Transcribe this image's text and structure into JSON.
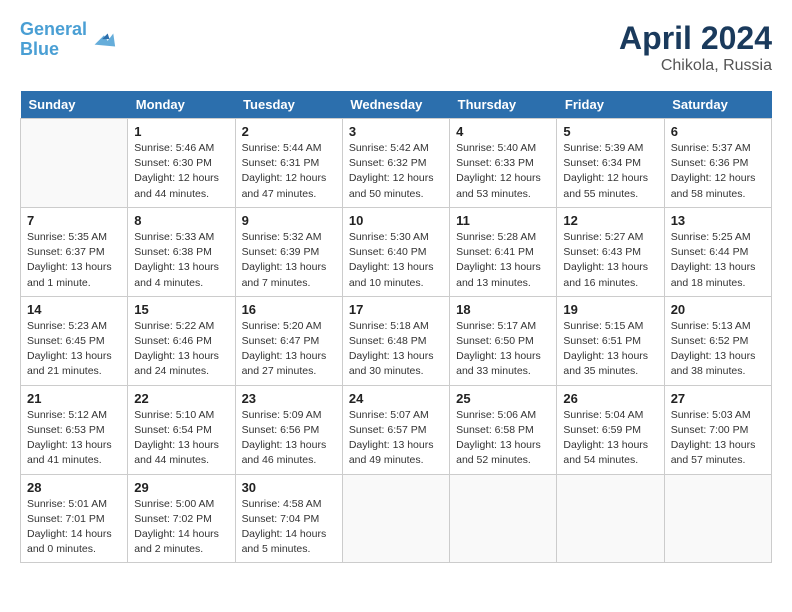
{
  "header": {
    "logo_line1": "General",
    "logo_line2": "Blue",
    "month": "April 2024",
    "location": "Chikola, Russia"
  },
  "days_of_week": [
    "Sunday",
    "Monday",
    "Tuesday",
    "Wednesday",
    "Thursday",
    "Friday",
    "Saturday"
  ],
  "weeks": [
    [
      {
        "date": "",
        "info": ""
      },
      {
        "date": "1",
        "info": "Sunrise: 5:46 AM\nSunset: 6:30 PM\nDaylight: 12 hours\nand 44 minutes."
      },
      {
        "date": "2",
        "info": "Sunrise: 5:44 AM\nSunset: 6:31 PM\nDaylight: 12 hours\nand 47 minutes."
      },
      {
        "date": "3",
        "info": "Sunrise: 5:42 AM\nSunset: 6:32 PM\nDaylight: 12 hours\nand 50 minutes."
      },
      {
        "date": "4",
        "info": "Sunrise: 5:40 AM\nSunset: 6:33 PM\nDaylight: 12 hours\nand 53 minutes."
      },
      {
        "date": "5",
        "info": "Sunrise: 5:39 AM\nSunset: 6:34 PM\nDaylight: 12 hours\nand 55 minutes."
      },
      {
        "date": "6",
        "info": "Sunrise: 5:37 AM\nSunset: 6:36 PM\nDaylight: 12 hours\nand 58 minutes."
      }
    ],
    [
      {
        "date": "7",
        "info": "Sunrise: 5:35 AM\nSunset: 6:37 PM\nDaylight: 13 hours\nand 1 minute."
      },
      {
        "date": "8",
        "info": "Sunrise: 5:33 AM\nSunset: 6:38 PM\nDaylight: 13 hours\nand 4 minutes."
      },
      {
        "date": "9",
        "info": "Sunrise: 5:32 AM\nSunset: 6:39 PM\nDaylight: 13 hours\nand 7 minutes."
      },
      {
        "date": "10",
        "info": "Sunrise: 5:30 AM\nSunset: 6:40 PM\nDaylight: 13 hours\nand 10 minutes."
      },
      {
        "date": "11",
        "info": "Sunrise: 5:28 AM\nSunset: 6:41 PM\nDaylight: 13 hours\nand 13 minutes."
      },
      {
        "date": "12",
        "info": "Sunrise: 5:27 AM\nSunset: 6:43 PM\nDaylight: 13 hours\nand 16 minutes."
      },
      {
        "date": "13",
        "info": "Sunrise: 5:25 AM\nSunset: 6:44 PM\nDaylight: 13 hours\nand 18 minutes."
      }
    ],
    [
      {
        "date": "14",
        "info": "Sunrise: 5:23 AM\nSunset: 6:45 PM\nDaylight: 13 hours\nand 21 minutes."
      },
      {
        "date": "15",
        "info": "Sunrise: 5:22 AM\nSunset: 6:46 PM\nDaylight: 13 hours\nand 24 minutes."
      },
      {
        "date": "16",
        "info": "Sunrise: 5:20 AM\nSunset: 6:47 PM\nDaylight: 13 hours\nand 27 minutes."
      },
      {
        "date": "17",
        "info": "Sunrise: 5:18 AM\nSunset: 6:48 PM\nDaylight: 13 hours\nand 30 minutes."
      },
      {
        "date": "18",
        "info": "Sunrise: 5:17 AM\nSunset: 6:50 PM\nDaylight: 13 hours\nand 33 minutes."
      },
      {
        "date": "19",
        "info": "Sunrise: 5:15 AM\nSunset: 6:51 PM\nDaylight: 13 hours\nand 35 minutes."
      },
      {
        "date": "20",
        "info": "Sunrise: 5:13 AM\nSunset: 6:52 PM\nDaylight: 13 hours\nand 38 minutes."
      }
    ],
    [
      {
        "date": "21",
        "info": "Sunrise: 5:12 AM\nSunset: 6:53 PM\nDaylight: 13 hours\nand 41 minutes."
      },
      {
        "date": "22",
        "info": "Sunrise: 5:10 AM\nSunset: 6:54 PM\nDaylight: 13 hours\nand 44 minutes."
      },
      {
        "date": "23",
        "info": "Sunrise: 5:09 AM\nSunset: 6:56 PM\nDaylight: 13 hours\nand 46 minutes."
      },
      {
        "date": "24",
        "info": "Sunrise: 5:07 AM\nSunset: 6:57 PM\nDaylight: 13 hours\nand 49 minutes."
      },
      {
        "date": "25",
        "info": "Sunrise: 5:06 AM\nSunset: 6:58 PM\nDaylight: 13 hours\nand 52 minutes."
      },
      {
        "date": "26",
        "info": "Sunrise: 5:04 AM\nSunset: 6:59 PM\nDaylight: 13 hours\nand 54 minutes."
      },
      {
        "date": "27",
        "info": "Sunrise: 5:03 AM\nSunset: 7:00 PM\nDaylight: 13 hours\nand 57 minutes."
      }
    ],
    [
      {
        "date": "28",
        "info": "Sunrise: 5:01 AM\nSunset: 7:01 PM\nDaylight: 14 hours\nand 0 minutes."
      },
      {
        "date": "29",
        "info": "Sunrise: 5:00 AM\nSunset: 7:02 PM\nDaylight: 14 hours\nand 2 minutes."
      },
      {
        "date": "30",
        "info": "Sunrise: 4:58 AM\nSunset: 7:04 PM\nDaylight: 14 hours\nand 5 minutes."
      },
      {
        "date": "",
        "info": ""
      },
      {
        "date": "",
        "info": ""
      },
      {
        "date": "",
        "info": ""
      },
      {
        "date": "",
        "info": ""
      }
    ]
  ]
}
